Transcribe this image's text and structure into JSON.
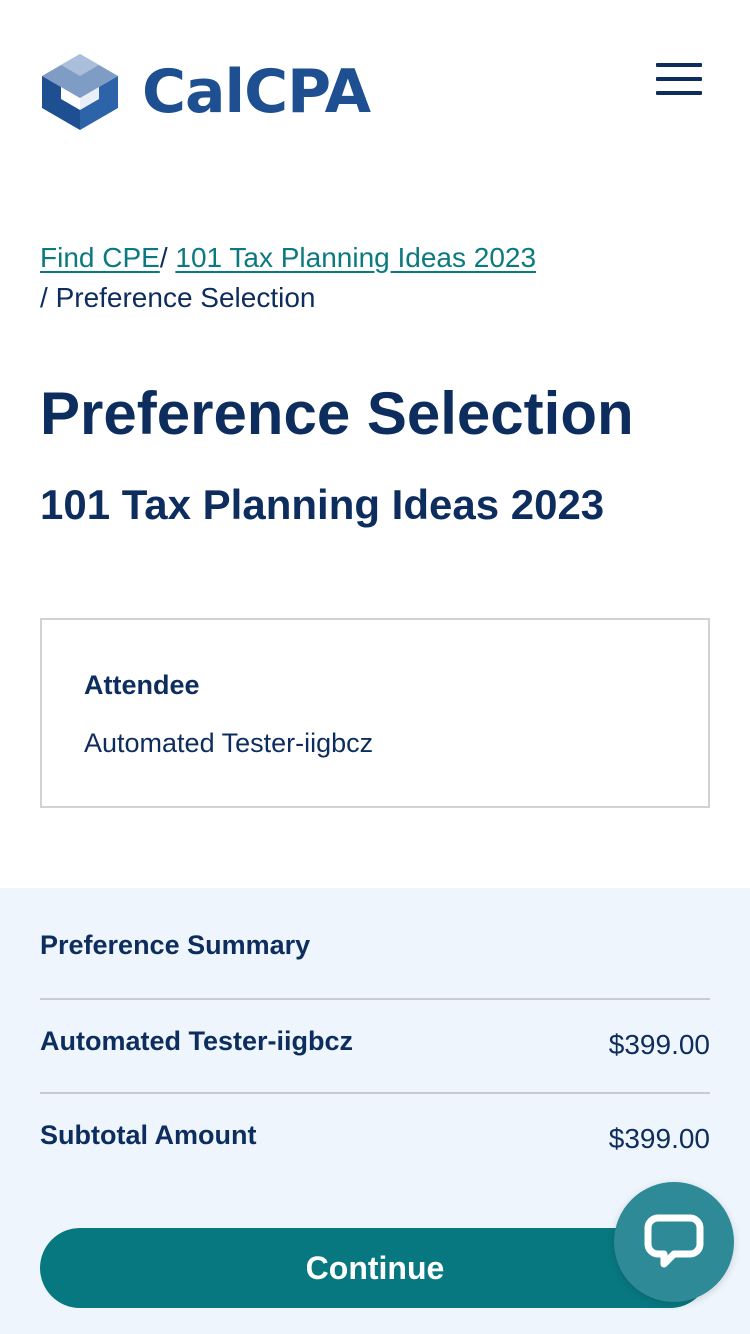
{
  "header": {
    "logo_text": "CalCPA",
    "menu_icon": "hamburger-menu-icon"
  },
  "breadcrumb": {
    "items": [
      {
        "label": "Find CPE"
      },
      {
        "label": "101 Tax Planning Ideas 2023"
      }
    ],
    "separator": "/",
    "current": "Preference Selection"
  },
  "page": {
    "title": "Preference Selection",
    "subtitle": "101 Tax Planning Ideas 2023"
  },
  "attendee": {
    "label": "Attendee",
    "name": "Automated Tester-iigbcz"
  },
  "summary": {
    "title": "Preference Summary",
    "rows": [
      {
        "label": "Automated Tester-iigbcz",
        "amount": "$399.00"
      },
      {
        "label": "Subtotal Amount",
        "amount": "$399.00"
      }
    ]
  },
  "actions": {
    "continue_label": "Continue"
  },
  "chat": {
    "icon": "chat-bubble-icon"
  },
  "colors": {
    "brand_blue": "#1d4f91",
    "navy_text": "#0d2d5e",
    "teal_link": "#0b7a80",
    "button_teal": "#087880",
    "summary_bg": "#eef5fc",
    "chat_bg": "#2e8a96"
  }
}
